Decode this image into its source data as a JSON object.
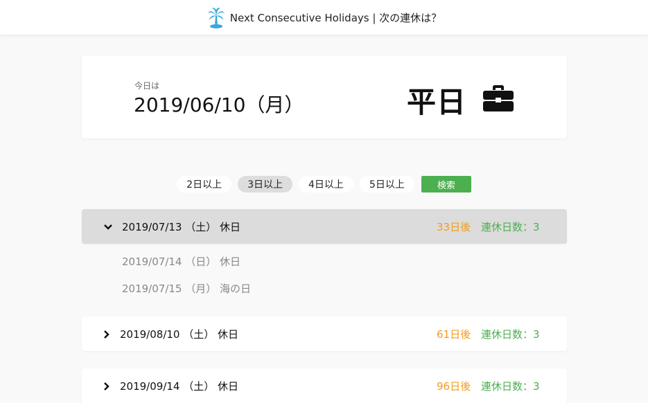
{
  "header": {
    "title": "Next Consecutive Holidays | 次の連休は？"
  },
  "today": {
    "label": "今日は",
    "date": "2019/06/10（月）",
    "day_type": "平日"
  },
  "filters": [
    {
      "label": "2日以上",
      "active": false
    },
    {
      "label": "3日以上",
      "active": true
    },
    {
      "label": "4日以上",
      "active": false
    },
    {
      "label": "5日以上",
      "active": false
    }
  ],
  "search_label": "検索",
  "holidays": [
    {
      "date": "2019/07/13 （土） 休日",
      "days_after": "33日後",
      "count": "連休日数：3",
      "expanded": true,
      "sub_days": [
        "2019/07/14 （日） 休日",
        "2019/07/15 （月） 海の日"
      ]
    },
    {
      "date": "2019/08/10 （土） 休日",
      "days_after": "61日後",
      "count": "連休日数：3",
      "expanded": false
    },
    {
      "date": "2019/09/14 （土） 休日",
      "days_after": "96日後",
      "count": "連休日数：3",
      "expanded": false
    }
  ],
  "colors": {
    "accent_green": "#4caf50",
    "accent_orange": "#f29b1d",
    "logo_blue": "#3aa7d8"
  }
}
